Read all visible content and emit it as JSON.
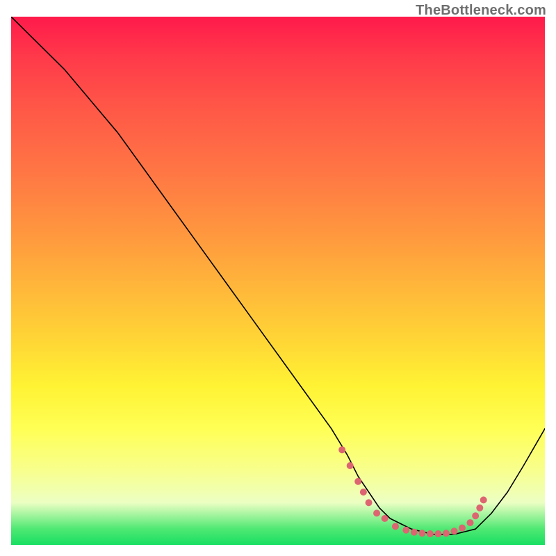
{
  "watermark": "TheBottleneck.com",
  "colors": {
    "dot": "#dd6571",
    "curve": "#000000"
  },
  "chart_data": {
    "type": "line",
    "title": "",
    "xlabel": "",
    "ylabel": "",
    "xlim": [
      0,
      100
    ],
    "ylim": [
      0,
      100
    ],
    "grid": false,
    "legend": false,
    "annotation": "TheBottleneck.com",
    "series": [
      {
        "name": "curve",
        "x": [
          0,
          5,
          10,
          15,
          20,
          25,
          30,
          35,
          40,
          45,
          50,
          55,
          60,
          63,
          65,
          67,
          69,
          71,
          73,
          75,
          77,
          79,
          81,
          83,
          85,
          87,
          90,
          93,
          96,
          100
        ],
        "y": [
          100,
          95,
          90,
          84,
          78,
          71,
          64,
          57,
          50,
          43,
          36,
          29,
          22,
          17,
          13,
          10,
          7,
          5,
          4,
          3,
          2.5,
          2,
          2,
          2,
          2.5,
          3,
          6,
          10,
          15,
          22
        ]
      }
    ],
    "highlight_points": {
      "comment": "dense pink dots along the valley floor near the minimum",
      "x": [
        62,
        63.5,
        65,
        66,
        67,
        68.5,
        70,
        72,
        74,
        75.5,
        77,
        78.5,
        80,
        81.5,
        83,
        84.5,
        86,
        87,
        87.8,
        88.5
      ],
      "y": [
        18,
        15,
        12,
        10,
        8,
        6,
        5,
        3.5,
        2.8,
        2.4,
        2.2,
        2.1,
        2.1,
        2.2,
        2.6,
        3.2,
        4.2,
        5.5,
        7,
        8.5
      ]
    }
  }
}
